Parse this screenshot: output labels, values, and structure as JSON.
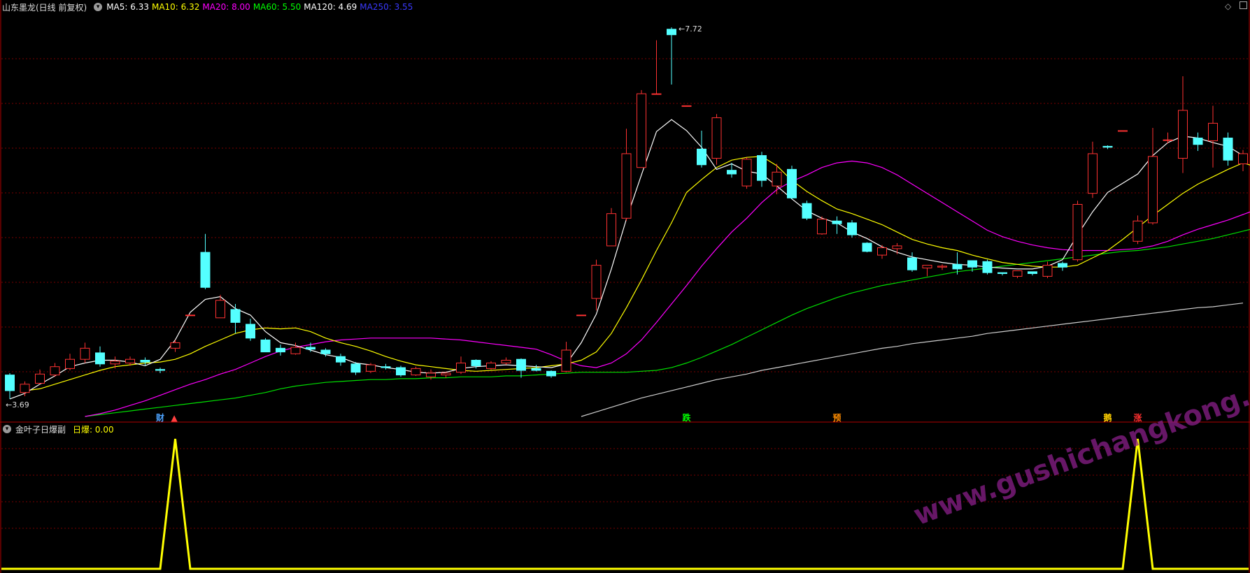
{
  "main": {
    "stock_name": "山东墨龙(日线 前复权)",
    "ma_legend": [
      {
        "label": "MA5: 6.33",
        "color": "#ffffff"
      },
      {
        "label": "MA10: 6.32",
        "color": "#ffff00"
      },
      {
        "label": "MA20: 8.00",
        "color": "#ff00ff"
      },
      {
        "label": "MA60: 5.50",
        "color": "#00ff00"
      },
      {
        "label": "MA120: 4.69",
        "color": "#ffffff"
      },
      {
        "label": "MA250: 3.55",
        "color": "#3a3aff"
      }
    ],
    "high_label": "7.72",
    "low_label": "3.69",
    "markers": [
      {
        "text": "财",
        "color": "#4da3ff",
        "index": 10
      },
      {
        "text": "▲",
        "color": "#ff4040",
        "index": 11
      },
      {
        "text": "跌",
        "color": "#00ff00",
        "index": 45
      },
      {
        "text": "预",
        "color": "#ff8c00",
        "index": 55
      },
      {
        "text": "鹅",
        "color": "#ffd000",
        "index": 73
      },
      {
        "text": "涨",
        "color": "#ff3030",
        "index": 75
      }
    ]
  },
  "sub": {
    "indicator_name": "金叶子日爆副",
    "indicator_value": "日爆: 0.00",
    "watermark": "www.gushichangkong.com"
  },
  "colors": {
    "up": "#ff3232",
    "down": "#54ffff",
    "grid": "#7a0000",
    "border": "#b00000"
  },
  "chart_data": {
    "type": "candlestick",
    "ohlc": [
      [
        3.95,
        3.78,
        3.97,
        3.69
      ],
      [
        3.76,
        3.85,
        3.88,
        3.72
      ],
      [
        3.86,
        3.96,
        4.01,
        3.85
      ],
      [
        3.95,
        4.04,
        4.08,
        3.93
      ],
      [
        4.02,
        4.12,
        4.18,
        4.0
      ],
      [
        4.12,
        4.24,
        4.3,
        4.08
      ],
      [
        4.19,
        4.07,
        4.26,
        4.04
      ],
      [
        4.07,
        4.1,
        4.15,
        4.02
      ],
      [
        4.08,
        4.12,
        4.15,
        4.05
      ],
      [
        4.11,
        4.09,
        4.14,
        4.05
      ],
      [
        4.01,
        4.0,
        4.03,
        3.97
      ],
      [
        4.24,
        4.3,
        4.33,
        4.2
      ],
      [
        4.6,
        4.6,
        4.6,
        4.6
      ],
      [
        5.28,
        4.9,
        5.48,
        4.88
      ],
      [
        4.57,
        4.76,
        4.82,
        4.57
      ],
      [
        4.66,
        4.52,
        4.72,
        4.4
      ],
      [
        4.5,
        4.35,
        4.56,
        4.32
      ],
      [
        4.33,
        4.2,
        4.35,
        4.2
      ],
      [
        4.24,
        4.2,
        4.28,
        4.16
      ],
      [
        4.18,
        4.25,
        4.3,
        4.17
      ],
      [
        4.25,
        4.23,
        4.3,
        4.2
      ],
      [
        4.22,
        4.18,
        4.24,
        4.15
      ],
      [
        4.15,
        4.09,
        4.18,
        4.05
      ],
      [
        4.07,
        3.98,
        4.09,
        3.95
      ],
      [
        3.99,
        4.06,
        4.08,
        3.97
      ],
      [
        4.04,
        4.03,
        4.07,
        4.01
      ],
      [
        4.03,
        3.95,
        4.05,
        3.93
      ],
      [
        3.95,
        4.02,
        4.04,
        3.94
      ],
      [
        3.93,
        3.97,
        4.01,
        3.9
      ],
      [
        3.95,
        3.97,
        3.98,
        3.92
      ],
      [
        3.98,
        4.08,
        4.15,
        3.96
      ],
      [
        4.11,
        4.05,
        4.12,
        4.02
      ],
      [
        4.02,
        4.08,
        4.1,
        4.01
      ],
      [
        4.08,
        4.11,
        4.14,
        4.06
      ],
      [
        4.12,
        4.0,
        4.13,
        3.92
      ],
      [
        4.02,
        4.0,
        4.06,
        3.99
      ],
      [
        3.99,
        3.94,
        4.0,
        3.92
      ],
      [
        3.99,
        4.22,
        4.31,
        3.98
      ],
      [
        4.6,
        4.6,
        4.6,
        4.6
      ],
      [
        4.78,
        5.14,
        5.2,
        4.65
      ],
      [
        5.35,
        5.7,
        5.76,
        5.35
      ],
      [
        5.65,
        6.35,
        6.62,
        5.62
      ],
      [
        6.2,
        7.0,
        7.04,
        6.2
      ],
      [
        7.0,
        7.0,
        7.58,
        7.0
      ],
      [
        7.7,
        7.64,
        7.72,
        7.1
      ],
      [
        6.87,
        6.87,
        6.87,
        6.87
      ],
      [
        6.4,
        6.23,
        6.6,
        6.2
      ],
      [
        6.3,
        6.74,
        6.78,
        6.23
      ],
      [
        6.17,
        6.13,
        6.25,
        6.09
      ],
      [
        6.0,
        6.29,
        6.31,
        5.97
      ],
      [
        6.33,
        6.06,
        6.37,
        5.99
      ],
      [
        6.0,
        6.15,
        6.24,
        5.91
      ],
      [
        6.18,
        5.87,
        6.22,
        5.86
      ],
      [
        5.81,
        5.65,
        5.84,
        5.63
      ],
      [
        5.48,
        5.64,
        5.67,
        5.47
      ],
      [
        5.62,
        5.59,
        5.67,
        5.48
      ],
      [
        5.6,
        5.47,
        5.63,
        5.44
      ],
      [
        5.38,
        5.29,
        5.39,
        5.28
      ],
      [
        5.25,
        5.33,
        5.36,
        5.21
      ],
      [
        5.32,
        5.35,
        5.38,
        5.26
      ],
      [
        5.22,
        5.09,
        5.28,
        5.07
      ],
      [
        5.11,
        5.14,
        5.14,
        5.02
      ],
      [
        5.12,
        5.13,
        5.15,
        5.09
      ],
      [
        5.15,
        5.1,
        5.28,
        5.04
      ],
      [
        5.19,
        5.12,
        5.19,
        5.07
      ],
      [
        5.18,
        5.06,
        5.2,
        5.04
      ],
      [
        5.06,
        5.05,
        5.06,
        5.03
      ],
      [
        5.02,
        5.08,
        5.08,
        5.0
      ],
      [
        5.07,
        5.05,
        5.07,
        5.03
      ],
      [
        5.02,
        5.14,
        5.18,
        5.0
      ],
      [
        5.16,
        5.12,
        5.18,
        5.08
      ],
      [
        5.2,
        5.8,
        5.84,
        5.18
      ],
      [
        5.92,
        6.35,
        6.48,
        5.87
      ],
      [
        6.43,
        6.42,
        6.44,
        6.4
      ],
      [
        6.6,
        6.6,
        6.6,
        6.6
      ],
      [
        5.4,
        5.62,
        5.68,
        5.37
      ],
      [
        5.6,
        6.32,
        6.63,
        5.58
      ],
      [
        6.5,
        6.5,
        6.58,
        6.46
      ],
      [
        6.3,
        6.82,
        7.19,
        6.14
      ],
      [
        6.52,
        6.45,
        6.58,
        6.38
      ],
      [
        6.49,
        6.68,
        6.87,
        6.2
      ],
      [
        6.52,
        6.28,
        6.58,
        6.22
      ],
      [
        6.24,
        6.35,
        6.39,
        6.16
      ],
      [
        6.36,
        6.12,
        6.41,
        6.1
      ]
    ],
    "ma5": [
      3.69,
      3.75,
      3.85,
      3.94,
      4.04,
      4.08,
      4.11,
      4.11,
      4.09,
      4.05,
      4.12,
      4.33,
      4.63,
      4.77,
      4.8,
      4.67,
      4.6,
      4.42,
      4.3,
      4.27,
      4.22,
      4.17,
      4.14,
      4.08,
      4.06,
      4.03,
      4.01,
      3.98,
      3.97,
      3.98,
      4.02,
      4.04,
      4.05,
      4.06,
      4.05,
      4.04,
      4.03,
      4.07,
      4.3,
      4.61,
      5.1,
      5.64,
      6.12,
      6.59,
      6.72,
      6.6,
      6.42,
      6.18,
      6.24,
      6.16,
      6.13,
      6.0,
      5.86,
      5.73,
      5.65,
      5.6,
      5.5,
      5.43,
      5.34,
      5.28,
      5.23,
      5.2,
      5.17,
      5.15,
      5.14,
      5.12,
      5.11,
      5.1,
      5.1,
      5.13,
      5.2,
      5.47,
      5.72,
      5.93,
      6.03,
      6.13,
      6.33,
      6.47,
      6.54,
      6.52,
      6.47,
      6.43,
      6.33
    ],
    "ma10": [
      3.78,
      3.8,
      3.85,
      3.9,
      3.95,
      4.0,
      4.04,
      4.06,
      4.08,
      4.09,
      4.12,
      4.18,
      4.26,
      4.33,
      4.4,
      4.44,
      4.46,
      4.45,
      4.46,
      4.42,
      4.35,
      4.3,
      4.26,
      4.21,
      4.15,
      4.1,
      4.06,
      4.04,
      4.02,
      4.0,
      3.99,
      4.0,
      4.01,
      4.02,
      4.03,
      4.05,
      4.07,
      4.11,
      4.2,
      4.4,
      4.68,
      4.98,
      5.3,
      5.6,
      5.93,
      6.07,
      6.2,
      6.28,
      6.31,
      6.32,
      6.22,
      6.06,
      5.94,
      5.84,
      5.75,
      5.7,
      5.64,
      5.58,
      5.5,
      5.42,
      5.37,
      5.33,
      5.3,
      5.25,
      5.21,
      5.17,
      5.15,
      5.13,
      5.12,
      5.12,
      5.14,
      5.22,
      5.3,
      5.42,
      5.55,
      5.68,
      5.8,
      5.92,
      6.02,
      6.1,
      6.18,
      6.25,
      6.2
    ],
    "ma20": [
      3.5,
      3.53,
      3.57,
      3.62,
      3.67,
      3.73,
      3.79,
      3.85,
      3.9,
      3.96,
      4.01,
      4.08,
      4.15,
      4.21,
      4.25,
      4.28,
      4.31,
      4.33,
      4.34,
      4.35,
      4.35,
      4.35,
      4.35,
      4.35,
      4.34,
      4.33,
      4.31,
      4.29,
      4.27,
      4.25,
      4.23,
      4.17,
      4.1,
      4.05,
      4.03,
      4.08,
      4.18,
      4.33,
      4.52,
      4.72,
      4.92,
      5.13,
      5.32,
      5.5,
      5.65,
      5.82,
      5.96,
      6.05,
      6.12,
      6.2,
      6.25,
      6.27,
      6.25,
      6.2,
      6.12,
      6.02,
      5.92,
      5.82,
      5.72,
      5.62,
      5.52,
      5.45,
      5.4,
      5.36,
      5.33,
      5.31,
      5.3,
      5.3,
      5.3,
      5.31,
      5.32,
      5.35,
      5.4,
      5.47,
      5.53,
      5.58,
      5.63,
      5.69,
      5.75,
      5.81,
      5.88,
      5.94,
      6.0
    ],
    "ma60": [
      3.5,
      3.52,
      3.54,
      3.56,
      3.58,
      3.6,
      3.62,
      3.64,
      3.66,
      3.68,
      3.7,
      3.73,
      3.76,
      3.8,
      3.83,
      3.85,
      3.87,
      3.88,
      3.89,
      3.9,
      3.9,
      3.91,
      3.91,
      3.92,
      3.92,
      3.93,
      3.93,
      3.93,
      3.94,
      3.94,
      3.95,
      3.96,
      3.97,
      3.98,
      3.98,
      3.98,
      3.98,
      3.99,
      4.0,
      4.03,
      4.08,
      4.14,
      4.21,
      4.28,
      4.36,
      4.44,
      4.52,
      4.6,
      4.67,
      4.73,
      4.79,
      4.84,
      4.88,
      4.92,
      4.95,
      4.98,
      5.01,
      5.04,
      5.07,
      5.09,
      5.11,
      5.13,
      5.15,
      5.17,
      5.19,
      5.21,
      5.23,
      5.25,
      5.27,
      5.29,
      5.3,
      5.32,
      5.34,
      5.37,
      5.4,
      5.43,
      5.47,
      5.51,
      5.55,
      5.59,
      5.63,
      5.67,
      5.71
    ],
    "ma120_start_index": 38,
    "ma120": [
      3.5,
      3.55,
      3.6,
      3.65,
      3.7,
      3.74,
      3.78,
      3.82,
      3.86,
      3.9,
      3.93,
      3.96,
      4.0,
      4.03,
      4.06,
      4.09,
      4.12,
      4.15,
      4.18,
      4.21,
      4.24,
      4.26,
      4.29,
      4.31,
      4.33,
      4.35,
      4.37,
      4.4,
      4.42,
      4.44,
      4.46,
      4.48,
      4.5,
      4.52,
      4.54,
      4.56,
      4.58,
      4.6,
      4.62,
      4.64,
      4.66,
      4.68,
      4.69,
      4.71,
      4.73
    ],
    "ymin": 3.5,
    "ymax": 7.85,
    "sub_values": [
      0,
      0,
      0,
      0,
      0,
      0,
      0,
      0,
      0,
      0,
      0,
      1,
      0,
      0,
      0,
      0,
      0,
      0,
      0,
      0,
      0,
      0,
      0,
      0,
      0,
      0,
      0,
      0,
      0,
      0,
      0,
      0,
      0,
      0,
      0,
      0,
      0,
      0,
      0,
      0,
      0,
      0,
      0,
      0,
      0,
      0,
      0,
      0,
      0,
      0,
      0,
      0,
      0,
      0,
      0,
      0,
      0,
      0,
      0,
      0,
      0,
      0,
      0,
      0,
      0,
      0,
      0,
      0,
      0,
      0,
      0,
      0,
      0,
      0,
      0,
      1,
      0,
      0,
      0,
      0,
      0,
      0,
      0
    ]
  }
}
